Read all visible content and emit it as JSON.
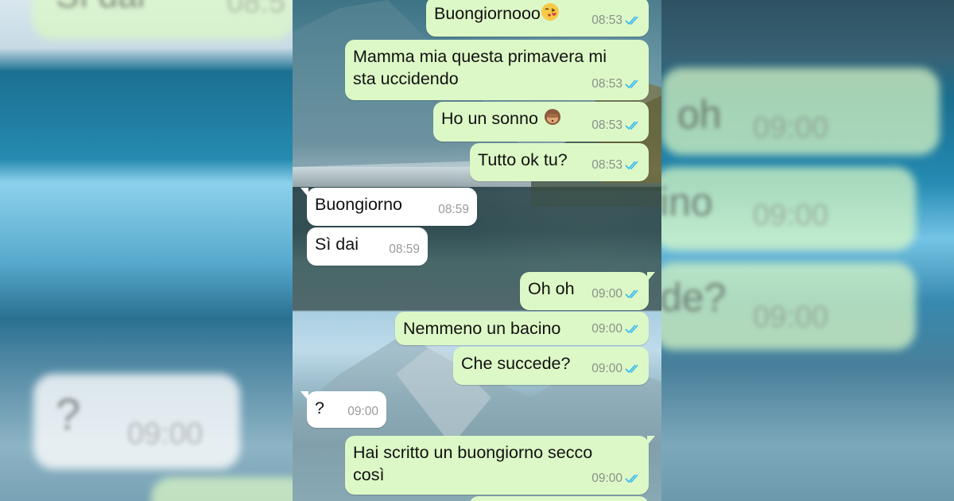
{
  "messages": [
    {
      "text": "Buongiornooo",
      "time": "08:53",
      "dir": "out",
      "emoji": "kiss-emoji"
    },
    {
      "text": "Mamma mia questa primavera mi sta uccidendo",
      "line1": "Mamma mia questa primavera mi",
      "line2": "sta uccidendo",
      "time": "08:53",
      "dir": "out"
    },
    {
      "text": "Ho un sonno",
      "time": "08:53",
      "dir": "out",
      "emoji": "see-no-evil-monkey-emoji"
    },
    {
      "text": "Tutto ok tu?",
      "time": "08:53",
      "dir": "out"
    },
    {
      "text": "Buongiorno",
      "time": "08:59",
      "dir": "in"
    },
    {
      "text": "Sì dai",
      "time": "08:59",
      "dir": "in"
    },
    {
      "text": "Oh oh",
      "time": "09:00",
      "dir": "out"
    },
    {
      "text": "Nemmeno un bacino",
      "time": "09:00",
      "dir": "out"
    },
    {
      "text": "Che succede?",
      "time": "09:00",
      "dir": "out"
    },
    {
      "text": "?",
      "time": "09:00",
      "dir": "in"
    },
    {
      "text": "Hai scritto un buongiorno secco così",
      "line1": "Hai scritto un buongiorno secco",
      "line2": "così",
      "time": "09:00",
      "dir": "out"
    }
  ],
  "colors": {
    "outgoing": "#dcf8c6",
    "incoming": "#ffffff",
    "read_tick": "#34b7f1"
  },
  "background_blur": {
    "left": {
      "message_fragment": "Sì dai",
      "time_fragment": "08:5",
      "question": "?",
      "question_time": "09:00"
    },
    "right": {
      "fragment_1": "oh",
      "fragment_2": "ino",
      "fragment_3": "de?",
      "time": "09:00"
    }
  }
}
